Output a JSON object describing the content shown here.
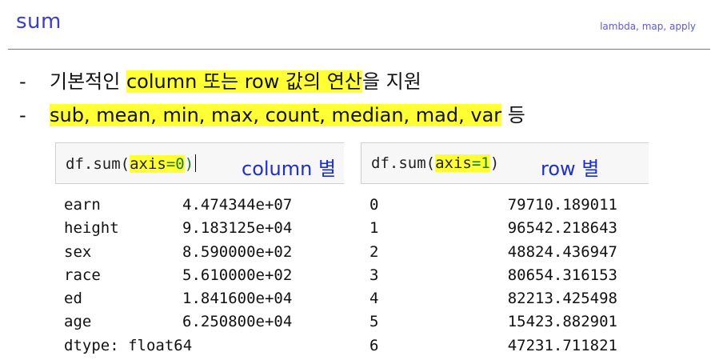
{
  "slide": {
    "title": "sum",
    "subtitle": "lambda, map, apply"
  },
  "bullets": [
    {
      "dash": "-",
      "pre": "기본적인 ",
      "highlight": "column 또는 row 값의 연산",
      "post": "을 지원"
    },
    {
      "dash": "-",
      "pre": "",
      "highlight": "sub, mean, min, max, count, median, mad, var",
      "post": " 등"
    }
  ],
  "colors": {
    "title": "#3b3bd6",
    "highlight": "#ffff33",
    "caption": "#1c2fd6",
    "code_keyword": "#1a7a1a"
  },
  "left_cell": {
    "code_prefix": "df.sum(",
    "code_arg_name": "axis",
    "code_arg_eq": "=",
    "code_arg_value": "0",
    "code_suffix": ")",
    "caption": "column 별",
    "output": [
      {
        "key": "earn",
        "value": "4.474344e+07"
      },
      {
        "key": "height",
        "value": "9.183125e+04"
      },
      {
        "key": "sex",
        "value": "8.590000e+02"
      },
      {
        "key": "race",
        "value": "5.610000e+02"
      },
      {
        "key": "ed",
        "value": "1.841600e+04"
      },
      {
        "key": "age",
        "value": "6.250800e+04"
      }
    ],
    "dtype": "dtype: float64"
  },
  "right_cell": {
    "code_prefix": "df.sum(",
    "code_arg_name": "axis",
    "code_arg_eq": "=",
    "code_arg_value": "1",
    "code_suffix": ")",
    "caption": "row 별",
    "output": [
      {
        "key": "0",
        "value": "79710.189011"
      },
      {
        "key": "1",
        "value": "96542.218643"
      },
      {
        "key": "2",
        "value": "48824.436947"
      },
      {
        "key": "3",
        "value": "80654.316153"
      },
      {
        "key": "4",
        "value": "82213.425498"
      },
      {
        "key": "5",
        "value": "15423.882901"
      },
      {
        "key": "6",
        "value": "47231.711821"
      }
    ]
  }
}
